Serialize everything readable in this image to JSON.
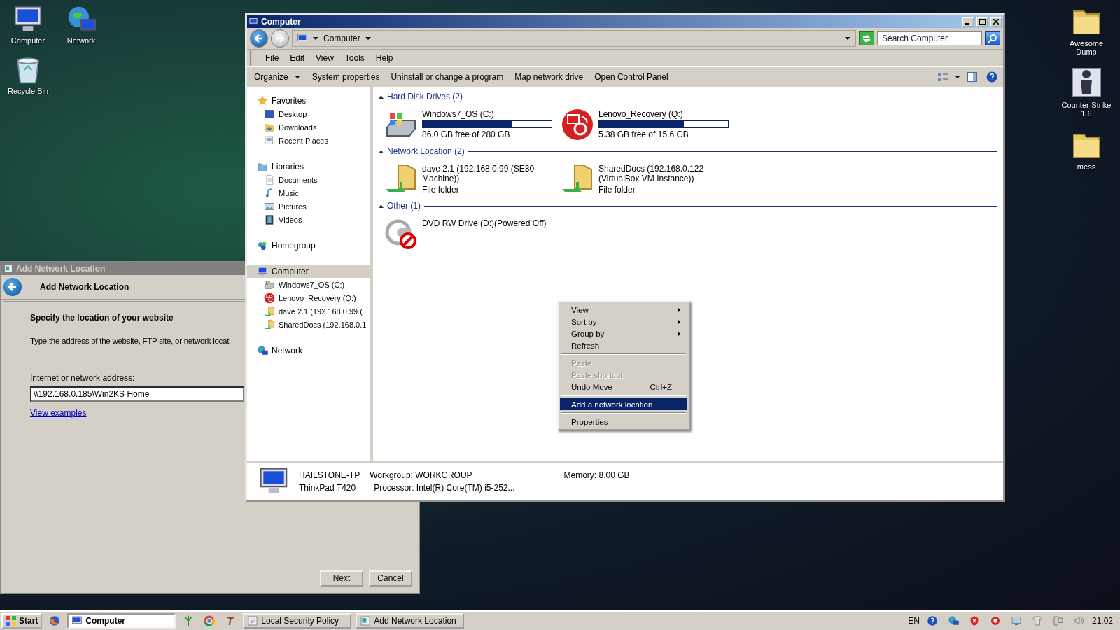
{
  "desktop_icons_left": [
    {
      "label": "Computer",
      "kind": "computer"
    },
    {
      "label": "Network",
      "kind": "network"
    },
    {
      "label": "Recycle Bin",
      "kind": "bin"
    }
  ],
  "desktop_icons_right": [
    {
      "label": "Awesome Dump",
      "kind": "folder"
    },
    {
      "label": "Counter-Strike 1.6",
      "kind": "game"
    },
    {
      "label": "mess",
      "kind": "folder"
    }
  ],
  "dialog": {
    "title": "Add Network Location",
    "header": "Add Network Location",
    "heading": "Specify the location of your website",
    "instruction": "Type the address of the website, FTP site, or network locati",
    "field_label": "Internet or network address:",
    "address": "\\\\192.168.0.185\\Win2KS Home",
    "link": "View examples",
    "buttons": [
      "Next",
      "Cancel"
    ]
  },
  "explorer": {
    "title": "Computer",
    "breadcrumb": "Computer",
    "search": {
      "placeholder": "Search Computer"
    },
    "menu": [
      "File",
      "Edit",
      "View",
      "Tools",
      "Help"
    ],
    "commands": [
      {
        "label": "Organize",
        "dropdown": true
      },
      {
        "label": "System properties",
        "dropdown": false
      },
      {
        "label": "Uninstall or change a program",
        "dropdown": false
      },
      {
        "label": "Map network drive",
        "dropdown": false
      },
      {
        "label": "Open Control Panel",
        "dropdown": false
      }
    ],
    "sidebar": [
      {
        "label": "Favorites",
        "kind": "star",
        "selected": false,
        "children": [
          {
            "label": "Desktop",
            "kind": "desktop",
            "selected": false
          },
          {
            "label": "Downloads",
            "kind": "downloads",
            "selected": false
          },
          {
            "label": "Recent Places",
            "kind": "recent",
            "selected": false
          }
        ]
      },
      {
        "label": "Libraries",
        "kind": "library",
        "selected": false,
        "children": [
          {
            "label": "Documents",
            "kind": "document",
            "selected": false
          },
          {
            "label": "Music",
            "kind": "music",
            "selected": false
          },
          {
            "label": "Pictures",
            "kind": "picture",
            "selected": false
          },
          {
            "label": "Videos",
            "kind": "video",
            "selected": false
          }
        ]
      },
      {
        "label": "Homegroup",
        "kind": "homegroup",
        "selected": false
      },
      {
        "label": "Computer",
        "kind": "computer",
        "selected": true,
        "children": [
          {
            "label": "Windows7_OS (C:)",
            "kind": "drive",
            "selected": false
          },
          {
            "label": "Lenovo_Recovery (Q:)",
            "kind": "recovery",
            "selected": false
          },
          {
            "label": "dave 2.1 (192.168.0.99 (",
            "kind": "netfolder",
            "selected": false
          },
          {
            "label": "SharedDocs (192.168.0.1",
            "kind": "netfolder",
            "selected": false
          }
        ]
      },
      {
        "label": "Network",
        "kind": "network",
        "selected": false
      }
    ],
    "groups": [
      {
        "title": "Hard Disk Drives (2)",
        "items": [
          {
            "kind": "drive",
            "name": "Windows7_OS (C:)",
            "level": 0.69,
            "free": "86.0 GB free of 280 GB"
          },
          {
            "kind": "recovery",
            "name": "Lenovo_Recovery (Q:)",
            "level": 0.66,
            "free": "5.38 GB free of 15.6 GB"
          }
        ]
      },
      {
        "title": "Network Location (2)",
        "items": [
          {
            "kind": "netfolder",
            "name": "dave 2.1 (192.168.0.99 (SE30 Machine))",
            "type": "File folder"
          },
          {
            "kind": "netfolder",
            "name": "SharedDocs (192.168.0.122 (VirtualBox VM Instance))",
            "type": "File folder"
          }
        ]
      },
      {
        "title": "Other (1)",
        "items": [
          {
            "kind": "dvd",
            "name": "DVD RW Drive (D:)(Powered Off)"
          }
        ]
      }
    ],
    "details": {
      "name": "HAILSTONE-TP",
      "model": "ThinkPad T420",
      "workgroup": "Workgroup: WORKGROUP",
      "memory": "Memory: 8.00 GB",
      "processor": "Processor: Intel(R) Core(TM) i5-252..."
    }
  },
  "context_menu": [
    [
      {
        "label": "View",
        "submenu": true,
        "disabled": false,
        "selected": false
      },
      {
        "label": "Sort by",
        "submenu": true,
        "disabled": false,
        "selected": false
      },
      {
        "label": "Group by",
        "submenu": true,
        "disabled": false,
        "selected": false
      },
      {
        "label": "Refresh",
        "submenu": false,
        "disabled": false,
        "selected": false
      }
    ],
    [
      {
        "label": "Paste",
        "submenu": false,
        "disabled": true,
        "selected": false
      },
      {
        "label": "Paste shortcut",
        "submenu": false,
        "disabled": true,
        "selected": false
      },
      {
        "label": "Undo Move",
        "shortcut": "Ctrl+Z",
        "submenu": false,
        "disabled": false,
        "selected": false
      }
    ],
    [
      {
        "label": "Add a network location",
        "submenu": false,
        "disabled": false,
        "selected": true
      }
    ],
    [
      {
        "label": "Properties",
        "submenu": false,
        "disabled": false,
        "selected": false
      }
    ]
  ],
  "taskbar": {
    "start": "Start",
    "tasks": [
      {
        "label": "Computer",
        "kind": "explorer",
        "selected": true
      },
      {
        "label": "Local Security Policy",
        "kind": "policy",
        "selected": false
      },
      {
        "label": "Add Network Location",
        "kind": "dialog",
        "selected": false
      }
    ],
    "language": "EN",
    "clock": "21:02"
  }
}
